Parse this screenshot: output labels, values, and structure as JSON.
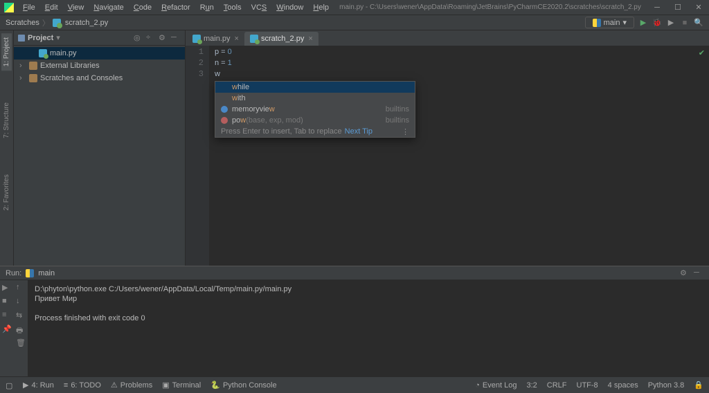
{
  "title": "main.py - C:\\Users\\wener\\AppData\\Roaming\\JetBrains\\PyCharmCE2020.2\\scratches\\scratch_2.py",
  "menu": [
    "File",
    "Edit",
    "View",
    "Navigate",
    "Code",
    "Refactor",
    "Run",
    "Tools",
    "VCS",
    "Window",
    "Help"
  ],
  "breadcrumbs": {
    "root": "Scratches",
    "file": "scratch_2.py"
  },
  "run_config": {
    "name": "main",
    "arrow": "▾"
  },
  "project_panel": {
    "label": "Project",
    "arrow": "▾"
  },
  "tree": {
    "main": "main.py",
    "ext": "External Libraries",
    "scr": "Scratches and Consoles"
  },
  "tabs": [
    {
      "name": "main.py",
      "active": false
    },
    {
      "name": "scratch_2.py",
      "active": true
    }
  ],
  "code": {
    "l1": {
      "n": "1",
      "var1": "p",
      "op": " = ",
      "val": "0"
    },
    "l2": {
      "n": "2",
      "var1": "n",
      "op": " = ",
      "val": "1"
    },
    "l3": {
      "n": "3",
      "txt": "w"
    }
  },
  "completion": {
    "items": [
      {
        "pre": "w",
        "text": "hile"
      },
      {
        "pre": "w",
        "text": "ith"
      },
      {
        "pre": "",
        "dot": "c",
        "text": "memoryvie",
        "suf": "w",
        "kind": "builtins"
      },
      {
        "pre": "",
        "dot": "f",
        "text": "po",
        "suf": "w",
        "args": "(base, exp, mod)",
        "kind": "builtins"
      }
    ],
    "hint": "Press Enter to insert, Tab to replace",
    "tip": "Next Tip"
  },
  "run": {
    "title": "Run:",
    "config": "main",
    "out_l1": "D:\\phyton\\python.exe C:/Users/wener/AppData/Local/Temp/main.py/main.py",
    "out_l2": "Привет Мир",
    "out_l3": "",
    "out_l4": "Process finished with exit code 0"
  },
  "left_tabs": {
    "project": "1: Project",
    "structure": "7: Structure",
    "favorites": "2: Favorites"
  },
  "status": {
    "run": "4: Run",
    "todo": "6: TODO",
    "problems": "Problems",
    "terminal": "Terminal",
    "pyconsole": "Python Console",
    "event": "Event Log",
    "pos": "3:2",
    "le": "CRLF",
    "enc": "UTF-8",
    "indent": "4 spaces",
    "py": "Python 3.8"
  }
}
